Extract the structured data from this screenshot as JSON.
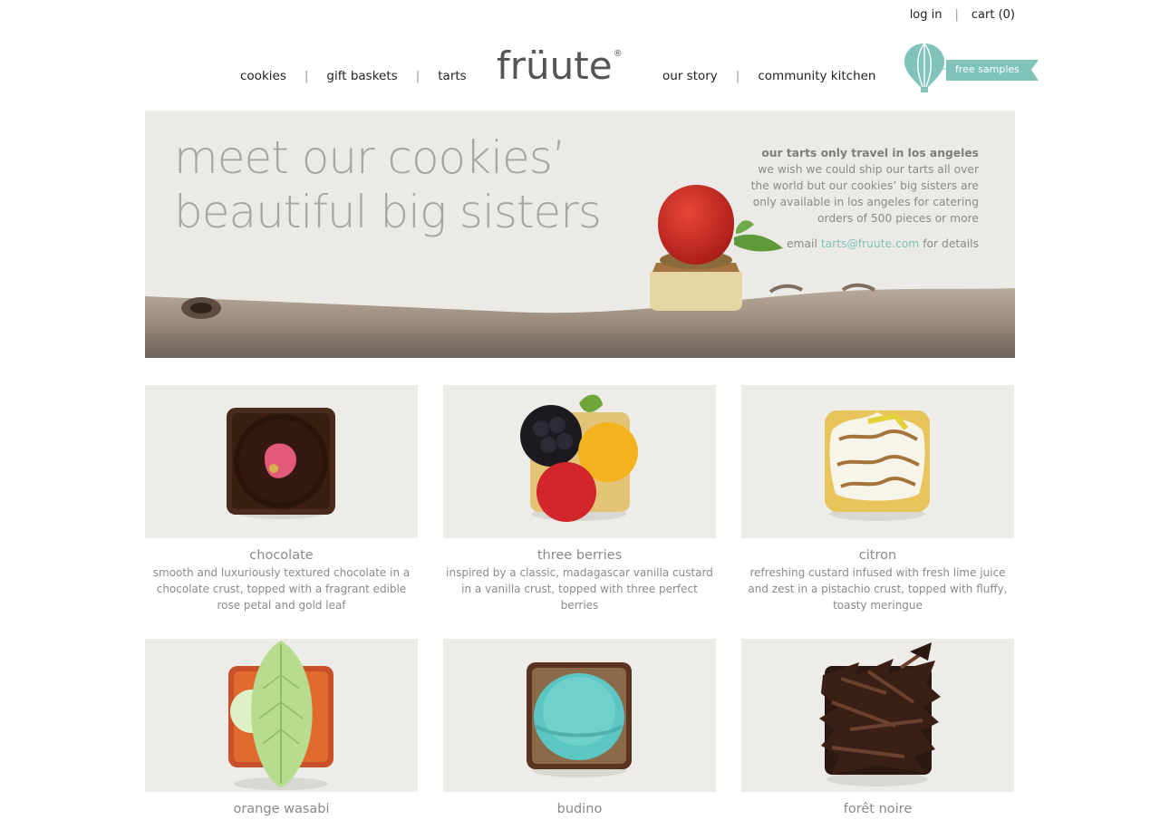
{
  "utility": {
    "login": "log in",
    "cart": "cart (0)"
  },
  "nav": {
    "left": [
      "cookies",
      "gift baskets",
      "tarts"
    ],
    "right": [
      "our story",
      "community kitchen"
    ]
  },
  "logo": {
    "text": "früute",
    "mark": "®"
  },
  "samples": {
    "label": "free samples"
  },
  "hero": {
    "title_line1": "meet our cookies’",
    "title_line2": "beautiful big sisters",
    "info_heading": "our tarts only travel in los angeles",
    "info_line1": "we wish we could ship our tarts all over",
    "info_line2": "the world but our cookies’ big sisters are",
    "info_line3": "only available in los angeles for catering",
    "info_line4": "orders of 500 pieces or more",
    "email_prefix": "email",
    "email": "tarts@fruute.com",
    "email_suffix": "for details"
  },
  "products": [
    {
      "name": "chocolate",
      "desc": "smooth and luxuriously textured chocolate in a chocolate crust, topped with a fragrant edible rose petal and gold leaf"
    },
    {
      "name": "three berries",
      "desc": "inspired by a classic, madagascar vanilla custard in a vanilla crust, topped with three perfect berries"
    },
    {
      "name": "citron",
      "desc": "refreshing custard infused with fresh lime juice and zest in a pistachio crust, topped with fluffy, toasty meringue"
    },
    {
      "name": "orange wasabi",
      "desc": ""
    },
    {
      "name": "budino",
      "desc": ""
    },
    {
      "name": "forêt noire",
      "desc": ""
    }
  ],
  "colors": {
    "accent": "#7fc3bb",
    "hero_bg": "#ebeae6",
    "tile_bg": "#edece8"
  }
}
